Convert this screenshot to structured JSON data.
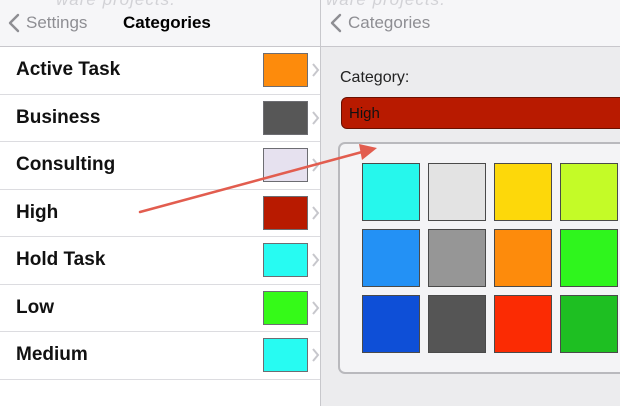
{
  "left": {
    "watermark": "ware projects.",
    "back_label": "Settings",
    "title": "Categories",
    "categories": [
      {
        "name": "Active Task",
        "color": "#fd8b0c"
      },
      {
        "name": "Business",
        "color": "#575757"
      },
      {
        "name": "Consulting",
        "color": "#e6e1ef"
      },
      {
        "name": "High",
        "color": "#b81a00"
      },
      {
        "name": "Hold Task",
        "color": "#27fbf2"
      },
      {
        "name": "Low",
        "color": "#35fa18"
      },
      {
        "name": "Medium",
        "color": "#27fbf2"
      }
    ]
  },
  "right": {
    "watermark": "ware projects.",
    "back_label": "Categories",
    "category_label": "Category:",
    "category_value": "High",
    "category_color": "#b81a00",
    "palette": [
      "#26f7ec",
      "#e3e3e3",
      "#fdd80a",
      "#c4fb27",
      "#2391f5",
      "#969696",
      "#fd8b0c",
      "#2ff51d",
      "#0e4fd7",
      "#555555",
      "#fb2b03",
      "#1ebf22"
    ]
  },
  "annotation": {
    "color": "#e25d4f"
  }
}
